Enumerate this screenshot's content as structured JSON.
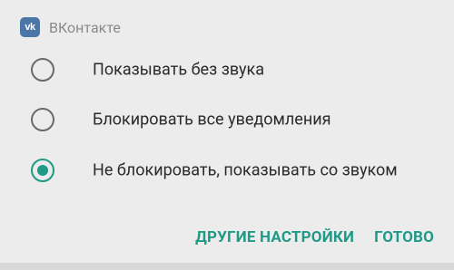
{
  "dialog": {
    "app_name": "ВКонтакте",
    "app_icon": "vk-logo-icon",
    "app_icon_text": "vk",
    "brand_color": "#4a76a8",
    "accent_color": "#1e9a86",
    "options": [
      {
        "label": "Показывать без звука",
        "selected": false
      },
      {
        "label": "Блокировать все уведомления",
        "selected": false
      },
      {
        "label": "Не блокировать, показывать со звуком",
        "selected": true
      }
    ],
    "actions": {
      "more_settings": "ДРУГИЕ НАСТРОЙКИ",
      "done": "ГОТОВО"
    }
  }
}
